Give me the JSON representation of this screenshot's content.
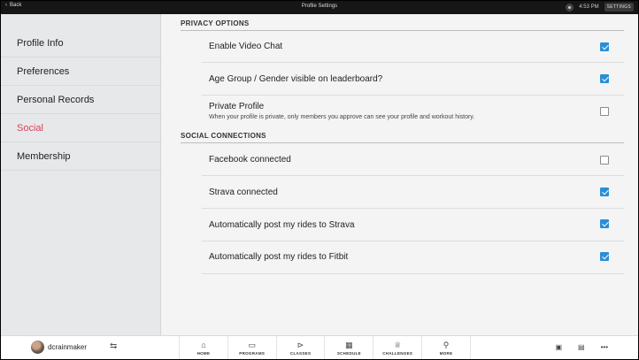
{
  "topbar": {
    "back_label": "Back",
    "title": "Profile Settings",
    "time": "4:53 PM",
    "settings_label": "SETTINGS"
  },
  "sidebar": {
    "items": [
      {
        "label": "Profile Info",
        "active": false
      },
      {
        "label": "Preferences",
        "active": false
      },
      {
        "label": "Personal Records",
        "active": false
      },
      {
        "label": "Social",
        "active": true
      },
      {
        "label": "Membership",
        "active": false
      }
    ]
  },
  "main": {
    "privacy": {
      "header": "PRIVACY OPTIONS",
      "rows": [
        {
          "label": "Enable Video Chat",
          "checked": true
        },
        {
          "label": "Age Group / Gender visible on leaderboard?",
          "checked": true
        },
        {
          "label": "Private Profile",
          "description": "When your profile is private, only members you approve can see your profile and workout history.",
          "checked": false
        }
      ]
    },
    "social": {
      "header": "SOCIAL CONNECTIONS",
      "rows": [
        {
          "label": "Facebook connected",
          "checked": false
        },
        {
          "label": "Strava connected",
          "checked": true
        },
        {
          "label": "Automatically post my rides to Strava",
          "checked": true
        },
        {
          "label": "Automatically post my rides to Fitbit",
          "checked": true
        }
      ]
    }
  },
  "bottombar": {
    "username": "dcrainmaker",
    "tabs": [
      {
        "label": "HOME",
        "icon": "home-icon"
      },
      {
        "label": "PROGRAMS",
        "icon": "programs-icon"
      },
      {
        "label": "CLASSES",
        "icon": "play-icon"
      },
      {
        "label": "SCHEDULE",
        "icon": "calendar-icon"
      },
      {
        "label": "CHALLENGES",
        "icon": "trophy-icon"
      },
      {
        "label": "MORE",
        "icon": "runner-icon"
      }
    ]
  },
  "colors": {
    "accent": "#d9435a",
    "checkbox": "#2a8ed8"
  }
}
